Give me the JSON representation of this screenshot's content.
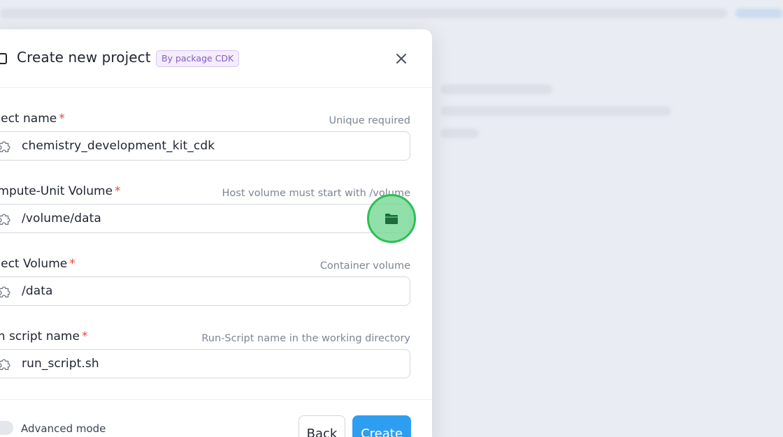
{
  "modal": {
    "title": "Create new project",
    "badge": "By package CDK",
    "close_icon": "close-icon"
  },
  "fields": [
    {
      "label": "oject name",
      "required_mark": "*",
      "hint": "Unique required",
      "value": "chemistry_development_kit_cdk",
      "icon": "puzzle-icon"
    },
    {
      "label": "ompute-Unit Volume",
      "required_mark": "*",
      "hint": "Host volume must start with /volume",
      "value": "/volume/data",
      "icon": "puzzle-icon",
      "action_icon": "folder-icon"
    },
    {
      "label": "oject Volume",
      "required_mark": "*",
      "hint": "Container volume",
      "value": "/data",
      "icon": "puzzle-icon"
    },
    {
      "label": "un script name",
      "required_mark": "*",
      "hint": "Run-Script name in the working directory",
      "value": "run_script.sh",
      "icon": "puzzle-icon"
    }
  ],
  "footer": {
    "toggle_label": "Advanced mode",
    "toggle_on": false,
    "back_label": "Back",
    "create_label": "Create"
  },
  "colors": {
    "primary": "#2e9ef0",
    "required": "#e04848",
    "badge_text": "#8a5ac8",
    "highlight": "#2cbf55"
  }
}
